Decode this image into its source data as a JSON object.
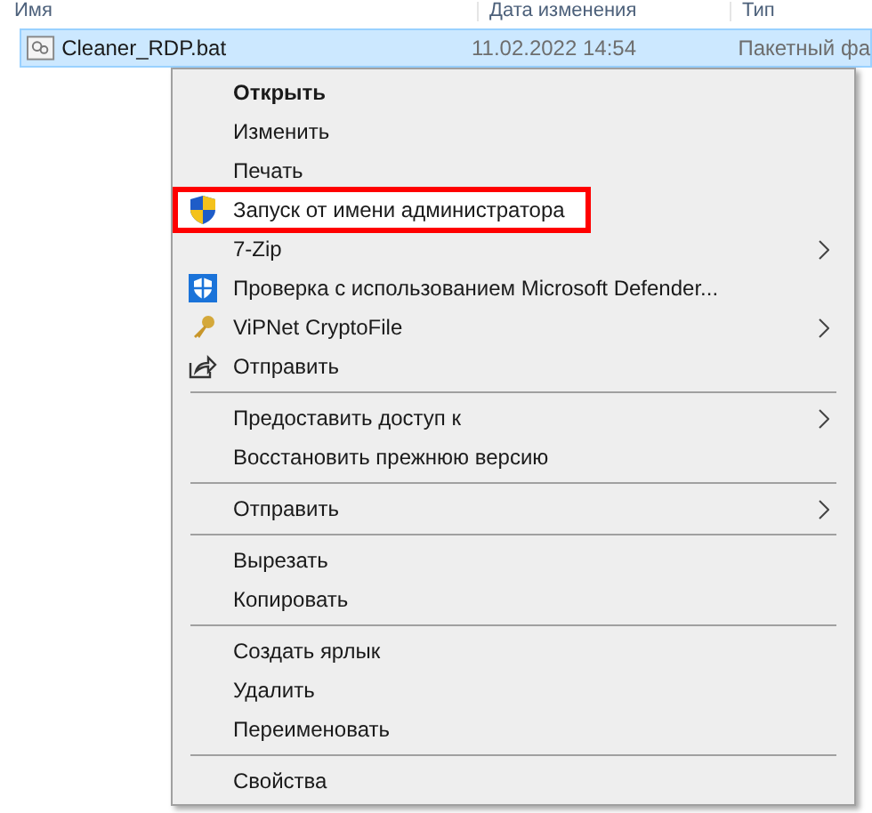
{
  "columns": [
    "Имя",
    "Дата изменения",
    "Тип"
  ],
  "file_row": {
    "name": "Cleaner_RDP.bat",
    "date": "11.02.2022 14:54",
    "type": "Пакетный фа",
    "selected": true
  },
  "context_menu": [
    {
      "kind": "item",
      "label": "Открыть",
      "bold": true,
      "hovered": false,
      "highlighted_box": false,
      "submenu": false
    },
    {
      "kind": "item",
      "label": "Изменить",
      "bold": false,
      "hovered": false,
      "highlighted_box": false,
      "submenu": false
    },
    {
      "kind": "item",
      "label": "Печать",
      "bold": false,
      "hovered": false,
      "highlighted_box": false,
      "submenu": false
    },
    {
      "kind": "shield",
      "label": "Запуск от имени администратора",
      "bold": false,
      "hovered": true,
      "highlighted_box": true,
      "submenu": false
    },
    {
      "kind": "item",
      "label": "7-Zip",
      "bold": false,
      "hovered": false,
      "highlighted_box": false,
      "submenu": true
    },
    {
      "kind": "defender",
      "label": "Проверка с использованием Microsoft Defender...",
      "bold": false,
      "hovered": false,
      "highlighted_box": false,
      "submenu": false
    },
    {
      "kind": "key",
      "label": "ViPNet CryptoFile",
      "bold": false,
      "hovered": false,
      "highlighted_box": false,
      "submenu": true
    },
    {
      "kind": "share",
      "label": "Отправить",
      "bold": false,
      "hovered": false,
      "highlighted_box": false,
      "submenu": false
    },
    {
      "kind": "separator"
    },
    {
      "kind": "item",
      "label": "Предоставить доступ к",
      "bold": false,
      "hovered": false,
      "highlighted_box": false,
      "submenu": true
    },
    {
      "kind": "item",
      "label": "Восстановить прежнюю версию",
      "bold": false,
      "hovered": false,
      "highlighted_box": false,
      "submenu": false
    },
    {
      "kind": "separator"
    },
    {
      "kind": "item",
      "label": "Отправить",
      "bold": false,
      "hovered": false,
      "highlighted_box": false,
      "submenu": true
    },
    {
      "kind": "separator"
    },
    {
      "kind": "item",
      "label": "Вырезать",
      "bold": false,
      "hovered": false,
      "highlighted_box": false,
      "submenu": false
    },
    {
      "kind": "item",
      "label": "Копировать",
      "bold": false,
      "hovered": false,
      "highlighted_box": false,
      "submenu": false
    },
    {
      "kind": "separator"
    },
    {
      "kind": "item",
      "label": "Создать ярлык",
      "bold": false,
      "hovered": false,
      "highlighted_box": false,
      "submenu": false
    },
    {
      "kind": "item",
      "label": "Удалить",
      "bold": false,
      "hovered": false,
      "highlighted_box": false,
      "submenu": false
    },
    {
      "kind": "item",
      "label": "Переименовать",
      "bold": false,
      "hovered": false,
      "highlighted_box": false,
      "submenu": false
    },
    {
      "kind": "separator"
    },
    {
      "kind": "item",
      "label": "Свойства",
      "bold": false,
      "hovered": false,
      "highlighted_box": false,
      "submenu": false
    }
  ]
}
